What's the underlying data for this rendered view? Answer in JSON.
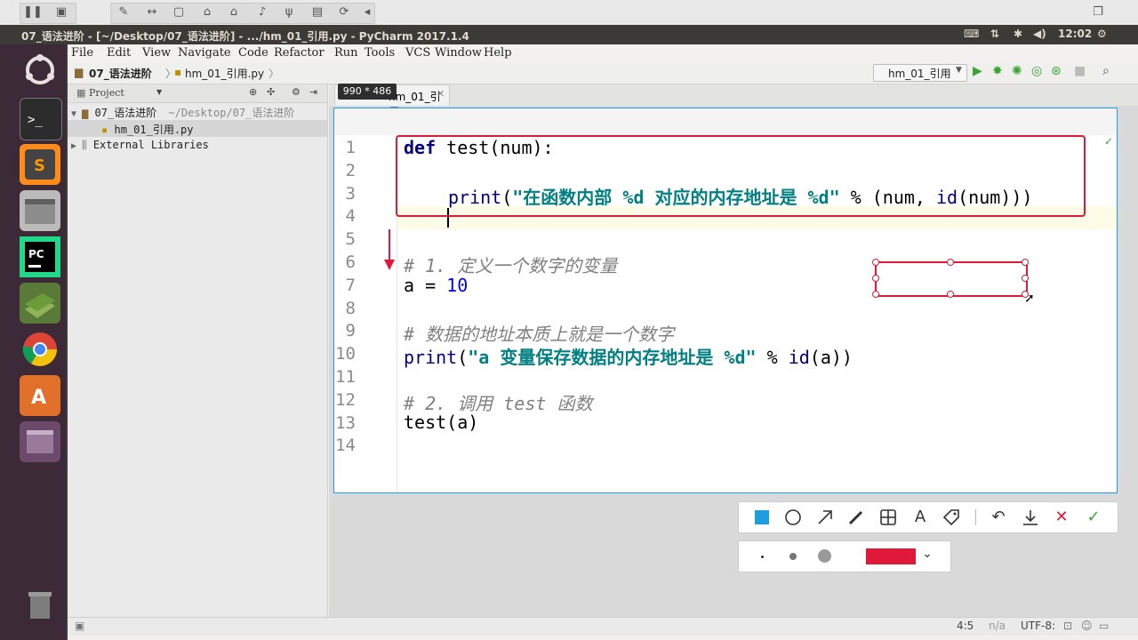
{
  "window": {
    "title": "07_语法进阶 - [~/Desktop/07_语法进阶] - .../hm_01_引用.py - PyCharm 2017.1.4"
  },
  "tray": {
    "time": "12:02"
  },
  "menu": [
    "File",
    "Edit",
    "View",
    "Navigate",
    "Code",
    "Refactor",
    "Run",
    "Tools",
    "VCS",
    "Window",
    "Help"
  ],
  "breadcrumb": {
    "project": "07_语法进阶",
    "file": "hm_01_引用.py"
  },
  "run_config": "hm_01_引用",
  "project_panel": {
    "header": "Project",
    "root": "07_语法进阶",
    "root_path": "~/Desktop/07_语法进阶",
    "file": "hm_01_引用.py",
    "external": "External Libraries"
  },
  "editor_tab": "hm_01_引用.py",
  "capture": {
    "size_label": "990 * 486"
  },
  "code_lines": [
    {
      "n": "1"
    },
    {
      "n": "2"
    },
    {
      "n": "3"
    },
    {
      "n": "4"
    },
    {
      "n": "5"
    },
    {
      "n": "6"
    },
    {
      "n": "7"
    },
    {
      "n": "8"
    },
    {
      "n": "9"
    },
    {
      "n": "10"
    },
    {
      "n": "11"
    },
    {
      "n": "12"
    },
    {
      "n": "13"
    },
    {
      "n": "14"
    }
  ],
  "code": {
    "l1_kw": "def",
    "l1_rest": " test(num):",
    "l3_fn": "print",
    "l3_open": "(",
    "l3_str": "\"在函数内部 %d 对应的内存地址是 %d\"",
    "l3_mid": " % (num, ",
    "l3_id": "id",
    "l3_end": "(num)))",
    "l6": "# 1. 定义一个数字的变量",
    "l7_a": "a = ",
    "l7_num": "10",
    "l9": "# 数据的地址本质上就是一个数字",
    "l10_fn": "print",
    "l10_open": "(",
    "l10_str": "\"a 变量保存数据的内存地址是 %d\"",
    "l10_mid": " % ",
    "l10_id": "id",
    "l10_end": "(a))",
    "l12": "# 2. 调用 test 函数",
    "l13": "test(a)"
  },
  "status": {
    "position": "4:5",
    "separator": "n/a",
    "encoding": "UTF-8:"
  },
  "colors": {
    "accent": "#e0193a",
    "selection": "#1e9de0"
  }
}
